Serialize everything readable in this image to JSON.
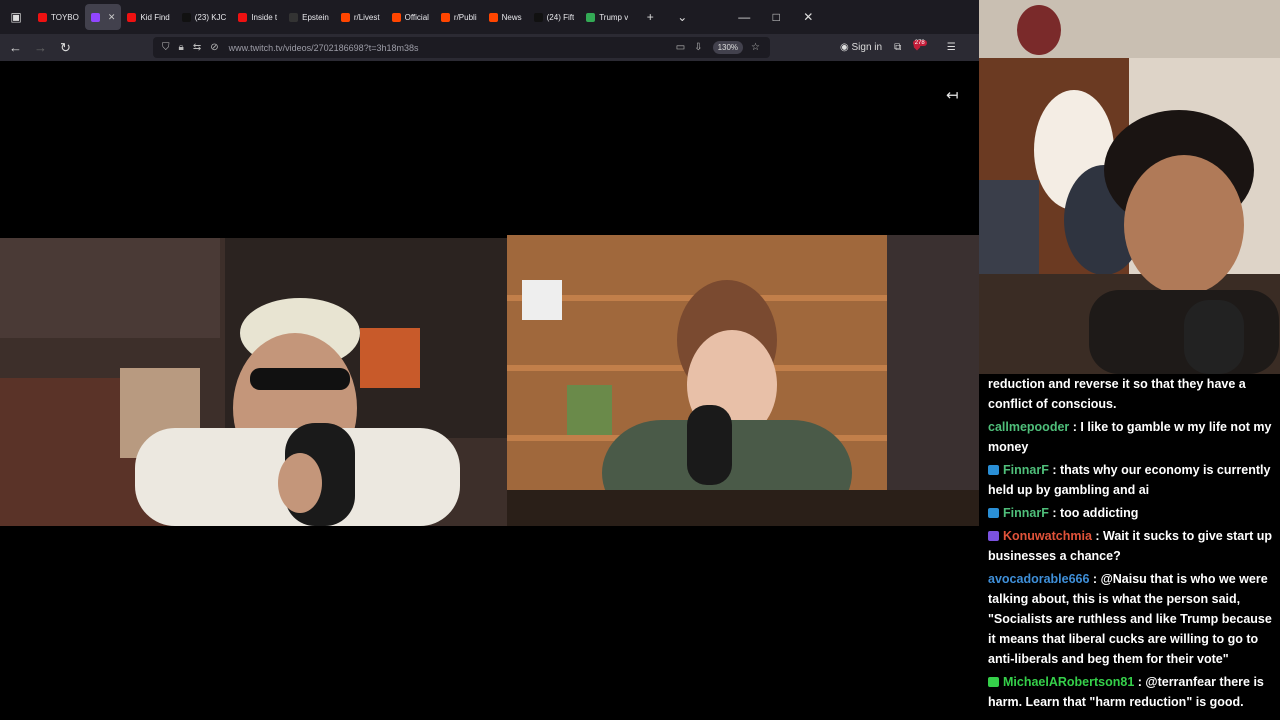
{
  "browser": {
    "tabs": [
      {
        "title": "TOYBO",
        "fav": "#e11"
      },
      {
        "title": "",
        "fav": "#9146ff",
        "active": true
      },
      {
        "title": "Kid Find",
        "fav": "#e11"
      },
      {
        "title": "(23) KJC",
        "fav": "#111"
      },
      {
        "title": "Inside t",
        "fav": "#e11"
      },
      {
        "title": "Epstein",
        "fav": "#333"
      },
      {
        "title": "r/Livest",
        "fav": "#ff4500"
      },
      {
        "title": "Official",
        "fav": "#ff4500"
      },
      {
        "title": "r/Publi",
        "fav": "#ff4500"
      },
      {
        "title": "News",
        "fav": "#ff4500"
      },
      {
        "title": "(24) Fift",
        "fav": "#111"
      },
      {
        "title": "Trump v",
        "fav": "#3a5"
      }
    ],
    "url": "www.twitch.tv/videos/2702186698?t=3h18m38s",
    "zoom": "130%",
    "sign_in": "Sign in",
    "badge_count": "278"
  },
  "chat": {
    "messages": [
      {
        "user": "",
        "color": "#fff",
        "text": "reduction and reverse it so that they have a conflict of conscious."
      },
      {
        "user": "callmepooder",
        "color": "#4fbf7a",
        "text": "I like to gamble w my life not my money"
      },
      {
        "user": "FinnarF",
        "color": "#4fbf7a",
        "text": "thats why our economy is currently held up by gambling and ai",
        "badge": "#2a8fd6"
      },
      {
        "user": "FinnarF",
        "color": "#4fbf7a",
        "text": "too addicting",
        "badge": "#2a8fd6"
      },
      {
        "user": "Konuwatchmia",
        "color": "#e0533a",
        "text": "Wait it sucks to give start up businesses a chance?",
        "badge": "#7b52e0"
      },
      {
        "user": "avocadorable666",
        "color": "#3f8fd8",
        "text": "@Naisu that is who we were talking about, this is what the person said, \"Socialists are ruthless and like Trump because it means that liberal cucks are willing to go to anti-liberals and beg them for their vote\""
      },
      {
        "user": "MichaelARobertson81",
        "color": "#35d04a",
        "text": "@terranfear there is harm. Learn that \"harm reduction\" is good.",
        "badge": "#35d04a"
      }
    ]
  }
}
